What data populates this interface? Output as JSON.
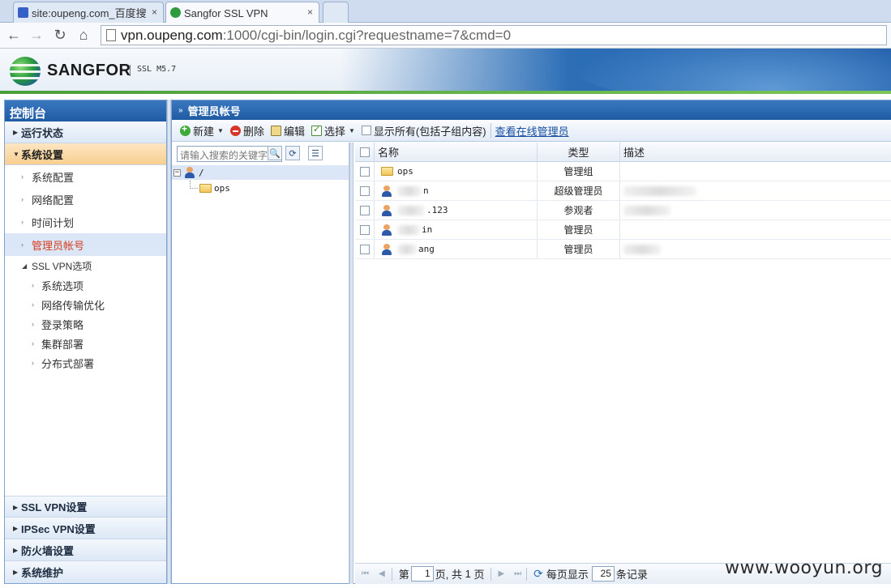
{
  "browser": {
    "tabs": [
      {
        "title": "site:oupeng.com_百度搜",
        "close": "×"
      },
      {
        "title": "Sangfor SSL VPN",
        "close": "×"
      }
    ],
    "url_host": "vpn.oupeng.com",
    "url_rest": ":1000/cgi-bin/login.cgi?requestname=7&cmd=0"
  },
  "header": {
    "brand": "SANGFOR",
    "version": "SSL M5.7"
  },
  "sidebar": {
    "title": "控制台",
    "sections_top": [
      {
        "label": "运行状态"
      },
      {
        "label": "系统设置"
      }
    ],
    "items": [
      {
        "label": "系统配置"
      },
      {
        "label": "网络配置"
      },
      {
        "label": "时间计划"
      },
      {
        "label": "管理员帐号"
      }
    ],
    "sub_group": "SSL VPN选项",
    "sub_items": [
      {
        "label": "系统选项"
      },
      {
        "label": "网络传输优化"
      },
      {
        "label": "登录策略"
      },
      {
        "label": "集群部署"
      },
      {
        "label": "分布式部署"
      }
    ],
    "sections_bottom": [
      {
        "label": "SSL VPN设置"
      },
      {
        "label": "IPSec VPN设置"
      },
      {
        "label": "防火墙设置"
      },
      {
        "label": "系统维护"
      }
    ]
  },
  "main": {
    "title": "管理员帐号",
    "toolbar": {
      "new": "新建",
      "delete": "删除",
      "edit": "编辑",
      "select": "选择",
      "show_all": "显示所有(包括子组内容)",
      "online_link": "查看在线管理员"
    },
    "tree": {
      "search_placeholder": "请输入搜索的关键字",
      "root": "/",
      "child": "ops"
    },
    "grid": {
      "columns": [
        "名称",
        "类型",
        "描述"
      ],
      "rows": [
        {
          "name": "ops",
          "type": "管理组"
        },
        {
          "name": "n",
          "type": "超级管理员"
        },
        {
          "name": ".123",
          "type": "参观者"
        },
        {
          "name": "in",
          "type": "管理员"
        },
        {
          "name": "ang",
          "type": "管理员"
        }
      ]
    },
    "pager": {
      "page_prefix": "第",
      "page": "1",
      "page_mid": "页, 共",
      "total": "1",
      "page_suffix": "页",
      "per_page_label": "每页显示",
      "per_page": "25",
      "records_label": "条记录"
    }
  },
  "watermark": "www.wooyun.org"
}
